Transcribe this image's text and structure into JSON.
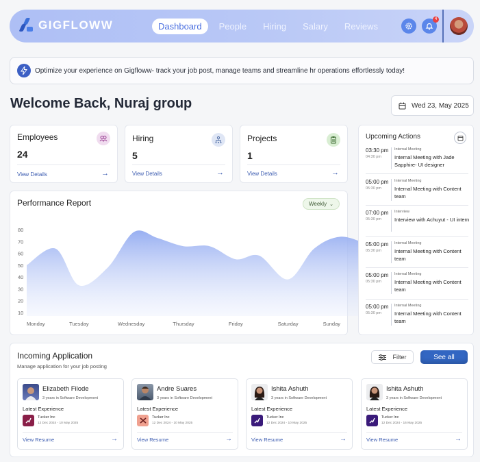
{
  "nav": {
    "logo": "GIGFLOWW",
    "links": [
      "Dashboard",
      "People",
      "Hiring",
      "Salary",
      "Reviews"
    ],
    "notification_count": "4"
  },
  "banner": {
    "text": "Optimize your experience on Gigfloww- track your job post, manage teams and streamline hr operations effortlessly today!"
  },
  "welcome": {
    "title": "Welcome Back, Nuraj group",
    "date": "Wed 23, May 2025"
  },
  "stats": [
    {
      "title": "Employees",
      "value": "24",
      "link": "View Details"
    },
    {
      "title": "Hiring",
      "value": "5",
      "link": "View Details"
    },
    {
      "title": "Projects",
      "value": "1",
      "link": "View Details"
    }
  ],
  "performance": {
    "title": "Performance Report",
    "filter": "Weekly"
  },
  "chart_data": {
    "type": "area",
    "categories": [
      "Monday",
      "Tuesday",
      "Wednesday",
      "Thursday",
      "Friday",
      "Saturday",
      "Sunday"
    ],
    "y_ticks": [
      80,
      70,
      60,
      50,
      40,
      30,
      20,
      10
    ],
    "ylim": [
      10,
      80
    ],
    "x": [
      0,
      0.55,
      1,
      1.55,
      2.05,
      2.5,
      3,
      3.5,
      4,
      4.45,
      5,
      5.5,
      6,
      6.5
    ],
    "values": [
      50,
      64,
      33,
      48,
      78,
      73,
      66,
      66,
      55,
      58,
      38,
      64,
      74,
      68
    ],
    "grid": false,
    "color": "#8fa8f0"
  },
  "upcoming": {
    "title": "Upcoming Actions",
    "events": [
      {
        "time": "03:30 pm",
        "end": "04:30 pm",
        "type": "Internal Meeting",
        "title": "Internal Meeting with Jade Sapphire- UI designer"
      },
      {
        "time": "05:00 pm",
        "end": "05:30 pm",
        "type": "Internal Meeting",
        "title": "Internal Meeting with Content team"
      },
      {
        "time": "07:00 pm",
        "end": "05:30 pm",
        "type": "Interview",
        "title": "Interview with Achuyut - UI intern"
      },
      {
        "time": "05:00 pm",
        "end": "05:30 pm",
        "type": "Internal Meeting",
        "title": "Internal Meeting with Content team"
      },
      {
        "time": "05:00 pm",
        "end": "05:30 pm",
        "type": "Internal Meeting",
        "title": "Internal Meeting with Content team"
      },
      {
        "time": "05:00 pm",
        "end": "05:30 pm",
        "type": "Internal Meeting",
        "title": "Internal Meeting with Content team"
      }
    ]
  },
  "incoming": {
    "title": "Incoming Application",
    "subtitle": "Manage application for your job posting",
    "filter": "Filter",
    "see_all": "See all",
    "applicants": [
      {
        "name": "Elizabeth Filode",
        "exp": "3 years in Software Development",
        "latest": "Latest Experience",
        "company": "Tucker Inc",
        "dates": "12 Dec 2024 - 10 May 2025",
        "resume": "View Resume"
      },
      {
        "name": "Andre Suares",
        "exp": "3 years in Software Development",
        "latest": "Latest Experience",
        "company": "Tucker Inc",
        "dates": "12 Dec 2024 - 10 May 2025",
        "resume": "View Resume"
      },
      {
        "name": "Ishita Ashuth",
        "exp": "3 years in Software Development",
        "latest": "Latest Experience",
        "company": "Tucker Inc",
        "dates": "12 Dec 2024 - 10 May 2025",
        "resume": "View Resume"
      },
      {
        "name": "Ishita Ashuth",
        "exp": "3 years in Software Development",
        "latest": "Latest Experience",
        "company": "Tucker Inc",
        "dates": "12 Dec 2024 - 16 May 2025",
        "resume": "View Resume"
      }
    ]
  }
}
